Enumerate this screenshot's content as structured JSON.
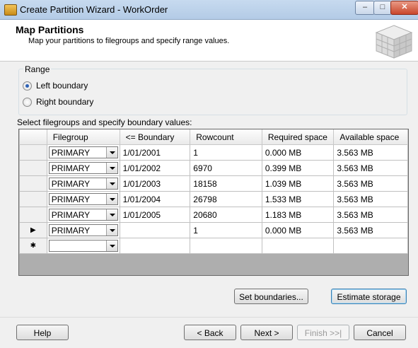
{
  "window": {
    "title": "Create Partition Wizard - WorkOrder",
    "min_glyph": "–",
    "max_glyph": "□",
    "close_glyph": "✕"
  },
  "header": {
    "title": "Map Partitions",
    "subtitle": "Map your partitions to filegroups and specify range values."
  },
  "range": {
    "legend": "Range",
    "options": [
      {
        "label": "Left boundary",
        "selected": true
      },
      {
        "label": "Right boundary",
        "selected": false
      }
    ]
  },
  "grid": {
    "label": "Select filegroups and specify boundary values:",
    "columns": [
      "Filegroup",
      "<= Boundary",
      "Rowcount",
      "Required space",
      "Available space"
    ],
    "rows": [
      {
        "indicator": "",
        "filegroup": "PRIMARY",
        "boundary": "1/01/2001",
        "rowcount": "1",
        "required": "0.000 MB",
        "available": "3.563 MB"
      },
      {
        "indicator": "",
        "filegroup": "PRIMARY",
        "boundary": "1/01/2002",
        "rowcount": "6970",
        "required": "0.399 MB",
        "available": "3.563 MB"
      },
      {
        "indicator": "",
        "filegroup": "PRIMARY",
        "boundary": "1/01/2003",
        "rowcount": "18158",
        "required": "1.039 MB",
        "available": "3.563 MB"
      },
      {
        "indicator": "",
        "filegroup": "PRIMARY",
        "boundary": "1/01/2004",
        "rowcount": "26798",
        "required": "1.533 MB",
        "available": "3.563 MB"
      },
      {
        "indicator": "",
        "filegroup": "PRIMARY",
        "boundary": "1/01/2005",
        "rowcount": "20680",
        "required": "1.183 MB",
        "available": "3.563 MB"
      },
      {
        "indicator": "▶",
        "filegroup": "PRIMARY",
        "boundary": "",
        "rowcount": "1",
        "required": "0.000 MB",
        "available": "3.563 MB"
      },
      {
        "indicator": "✱",
        "filegroup": "",
        "boundary": "",
        "rowcount": "",
        "required": "",
        "available": ""
      }
    ]
  },
  "actions": {
    "set_boundaries": "Set boundaries...",
    "estimate_storage": "Estimate storage"
  },
  "footer": {
    "help": "Help",
    "back": "< Back",
    "next": "Next >",
    "finish": "Finish >>|",
    "cancel": "Cancel"
  }
}
